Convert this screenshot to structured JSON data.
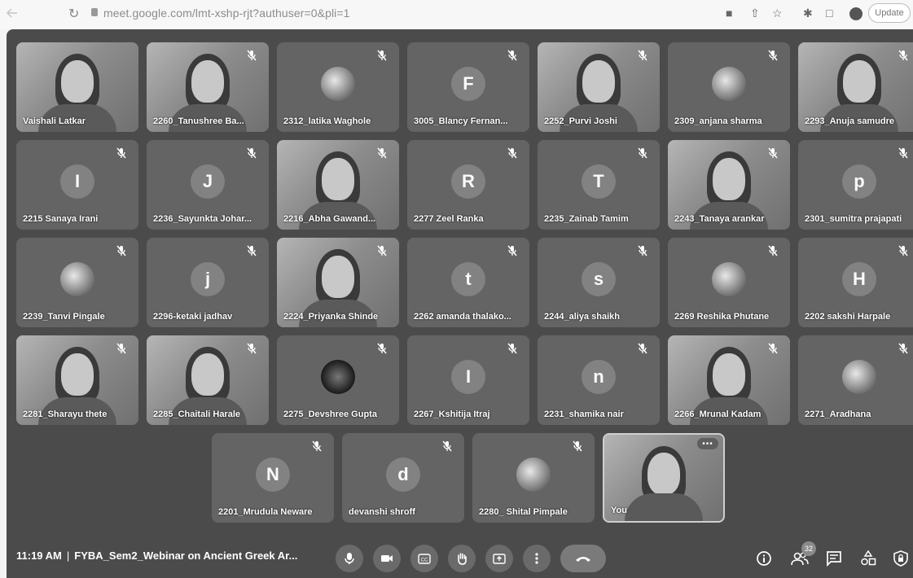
{
  "browser": {
    "url": "meet.google.com/lmt-xshp-rjt?authuser=0&pli=1",
    "update_label": "Update"
  },
  "participants": [
    {
      "name": "Vaishali Latkar",
      "kind": "video",
      "muted": false
    },
    {
      "name": "2260_Tanushree Ba...",
      "kind": "video",
      "muted": true
    },
    {
      "name": "2312_latika Waghole",
      "kind": "photo-avatar",
      "muted": true
    },
    {
      "name": "3005_Blancy Fernan...",
      "kind": "letter",
      "letter": "F",
      "muted": true
    },
    {
      "name": "2252_Purvi Joshi",
      "kind": "video",
      "muted": true
    },
    {
      "name": "2309_anjana sharma",
      "kind": "photo-avatar",
      "muted": true
    },
    {
      "name": "2293_Anuja samudre",
      "kind": "video",
      "muted": true
    },
    {
      "name": "2215 Sanaya Irani",
      "kind": "letter",
      "letter": "I",
      "muted": true
    },
    {
      "name": "2236_Sayunkta Johar...",
      "kind": "letter",
      "letter": "J",
      "muted": true
    },
    {
      "name": "2216_Abha Gawand...",
      "kind": "video",
      "muted": true
    },
    {
      "name": "2277 Zeel Ranka",
      "kind": "letter",
      "letter": "R",
      "muted": true
    },
    {
      "name": "2235_Zainab Tamim",
      "kind": "letter",
      "letter": "T",
      "muted": true
    },
    {
      "name": "2243_Tanaya arankar",
      "kind": "video",
      "muted": true
    },
    {
      "name": "2301_sumitra prajapati",
      "kind": "letter",
      "letter": "p",
      "muted": true
    },
    {
      "name": "2239_Tanvi Pingale",
      "kind": "photo-avatar",
      "muted": true
    },
    {
      "name": "2296-ketaki jadhav",
      "kind": "letter",
      "letter": "j",
      "muted": true
    },
    {
      "name": "2224_Priyanka Shinde",
      "kind": "video",
      "muted": true
    },
    {
      "name": "2262 amanda thalako...",
      "kind": "letter",
      "letter": "t",
      "muted": true
    },
    {
      "name": "2244_aliya shaikh",
      "kind": "letter",
      "letter": "s",
      "muted": true
    },
    {
      "name": "2269 Reshika Phutane",
      "kind": "photo-avatar",
      "muted": true
    },
    {
      "name": "2202 sakshi Harpale",
      "kind": "letter",
      "letter": "H",
      "muted": true
    },
    {
      "name": "2281_Sharayu thete",
      "kind": "video",
      "muted": true
    },
    {
      "name": "2285_Chaitali Harale",
      "kind": "video",
      "muted": true
    },
    {
      "name": "2275_Devshree Gupta",
      "kind": "dark-avatar",
      "muted": true
    },
    {
      "name": "2267_Kshitija Itraj",
      "kind": "letter",
      "letter": "I",
      "muted": true
    },
    {
      "name": "2231_shamika nair",
      "kind": "letter",
      "letter": "n",
      "muted": true
    },
    {
      "name": "2266_Mrunal Kadam",
      "kind": "video",
      "muted": true
    },
    {
      "name": "2271_Aradhana",
      "kind": "photo-avatar",
      "muted": true
    },
    {
      "name": "2201_Mrudula Neware",
      "kind": "letter",
      "letter": "N",
      "muted": true
    },
    {
      "name": "devanshi shroff",
      "kind": "letter",
      "letter": "d",
      "muted": true
    },
    {
      "name": "2280_ Shital Pimpale",
      "kind": "photo-avatar",
      "muted": true
    },
    {
      "name": "You",
      "kind": "self",
      "muted": false
    }
  ],
  "bottom_bar": {
    "time": "11:19 AM",
    "separator": "|",
    "meeting_title": "FYBA_Sem2_Webinar on Ancient Greek Ar...",
    "people_count": "32",
    "controls": [
      "microphone",
      "camera",
      "captions",
      "raise-hand",
      "present",
      "more-options",
      "end-call"
    ],
    "right_icons": [
      "info",
      "people",
      "chat",
      "activities",
      "host-controls"
    ]
  }
}
